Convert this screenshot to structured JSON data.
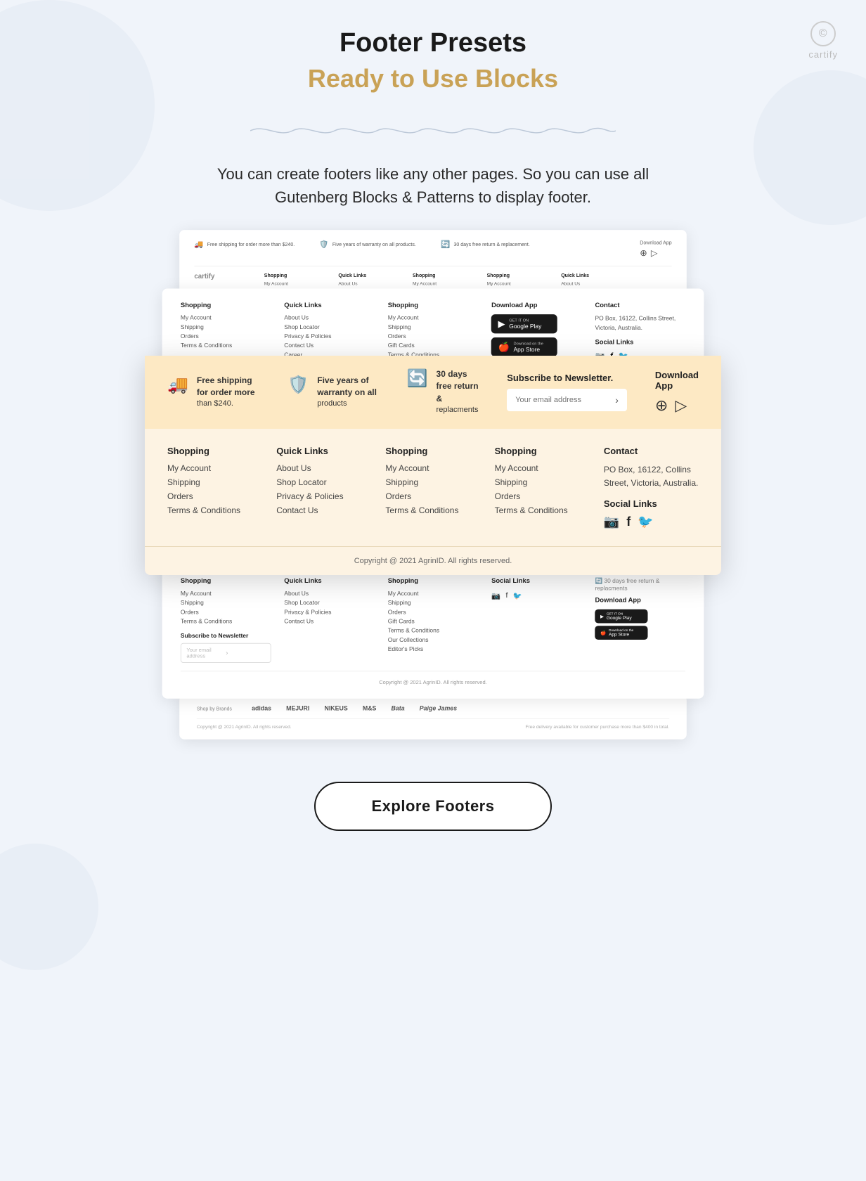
{
  "brand": {
    "name": "cartify",
    "icon": "©"
  },
  "header": {
    "title": "Footer Presets",
    "subtitle": "Ready to Use Blocks"
  },
  "description": "You can create footers like any other pages. So you can use all Gutenberg Blocks & Patterns to display footer.",
  "features": [
    {
      "icon": "🚚",
      "text": "Free shipping for order more than $240."
    },
    {
      "icon": "🛡️",
      "text": "Five years of warranty on all products"
    },
    {
      "icon": "🔄",
      "text": "30 days free return & replacments"
    }
  ],
  "footer_columns": {
    "shopping": {
      "title": "Shopping",
      "links": [
        "My Account",
        "Shipping",
        "Orders",
        "Terms & Conditions"
      ]
    },
    "quick_links": {
      "title": "Quick Links",
      "links": [
        "About Us",
        "Shop Locator",
        "Privacy & Policies",
        "Contact Us",
        "Career"
      ]
    },
    "shopping2": {
      "title": "Shopping",
      "links": [
        "My Account",
        "Shipping",
        "Orders",
        "Gift Cards",
        "Terms & Conditions"
      ]
    },
    "shopping3": {
      "title": "Shopping",
      "links": [
        "My Account",
        "Shipping",
        "Orders",
        "Terms & Conditions"
      ]
    },
    "contact": {
      "title": "Contact",
      "address": "PO Box, 16122, Collins Street, Victoria, Australia.",
      "social_title": "Social Links"
    }
  },
  "newsletter": {
    "label": "Subscribe to Newsletter.",
    "placeholder": "Your email address"
  },
  "download_app": {
    "label": "Download App",
    "google_play": "GET IT ON\nGoogle Play",
    "app_store": "Download on the\nApp Store"
  },
  "copyright": "Copyright @ 2021 AgrinID. All rights reserved.",
  "explore_btn": "Explore Footers",
  "brands": [
    "adidas",
    "MEJURI",
    "NIKEUS",
    "M&S",
    "Bata",
    "Paige James"
  ],
  "delivery_note": "Free delivery available for customer purchase more than $400 in total."
}
